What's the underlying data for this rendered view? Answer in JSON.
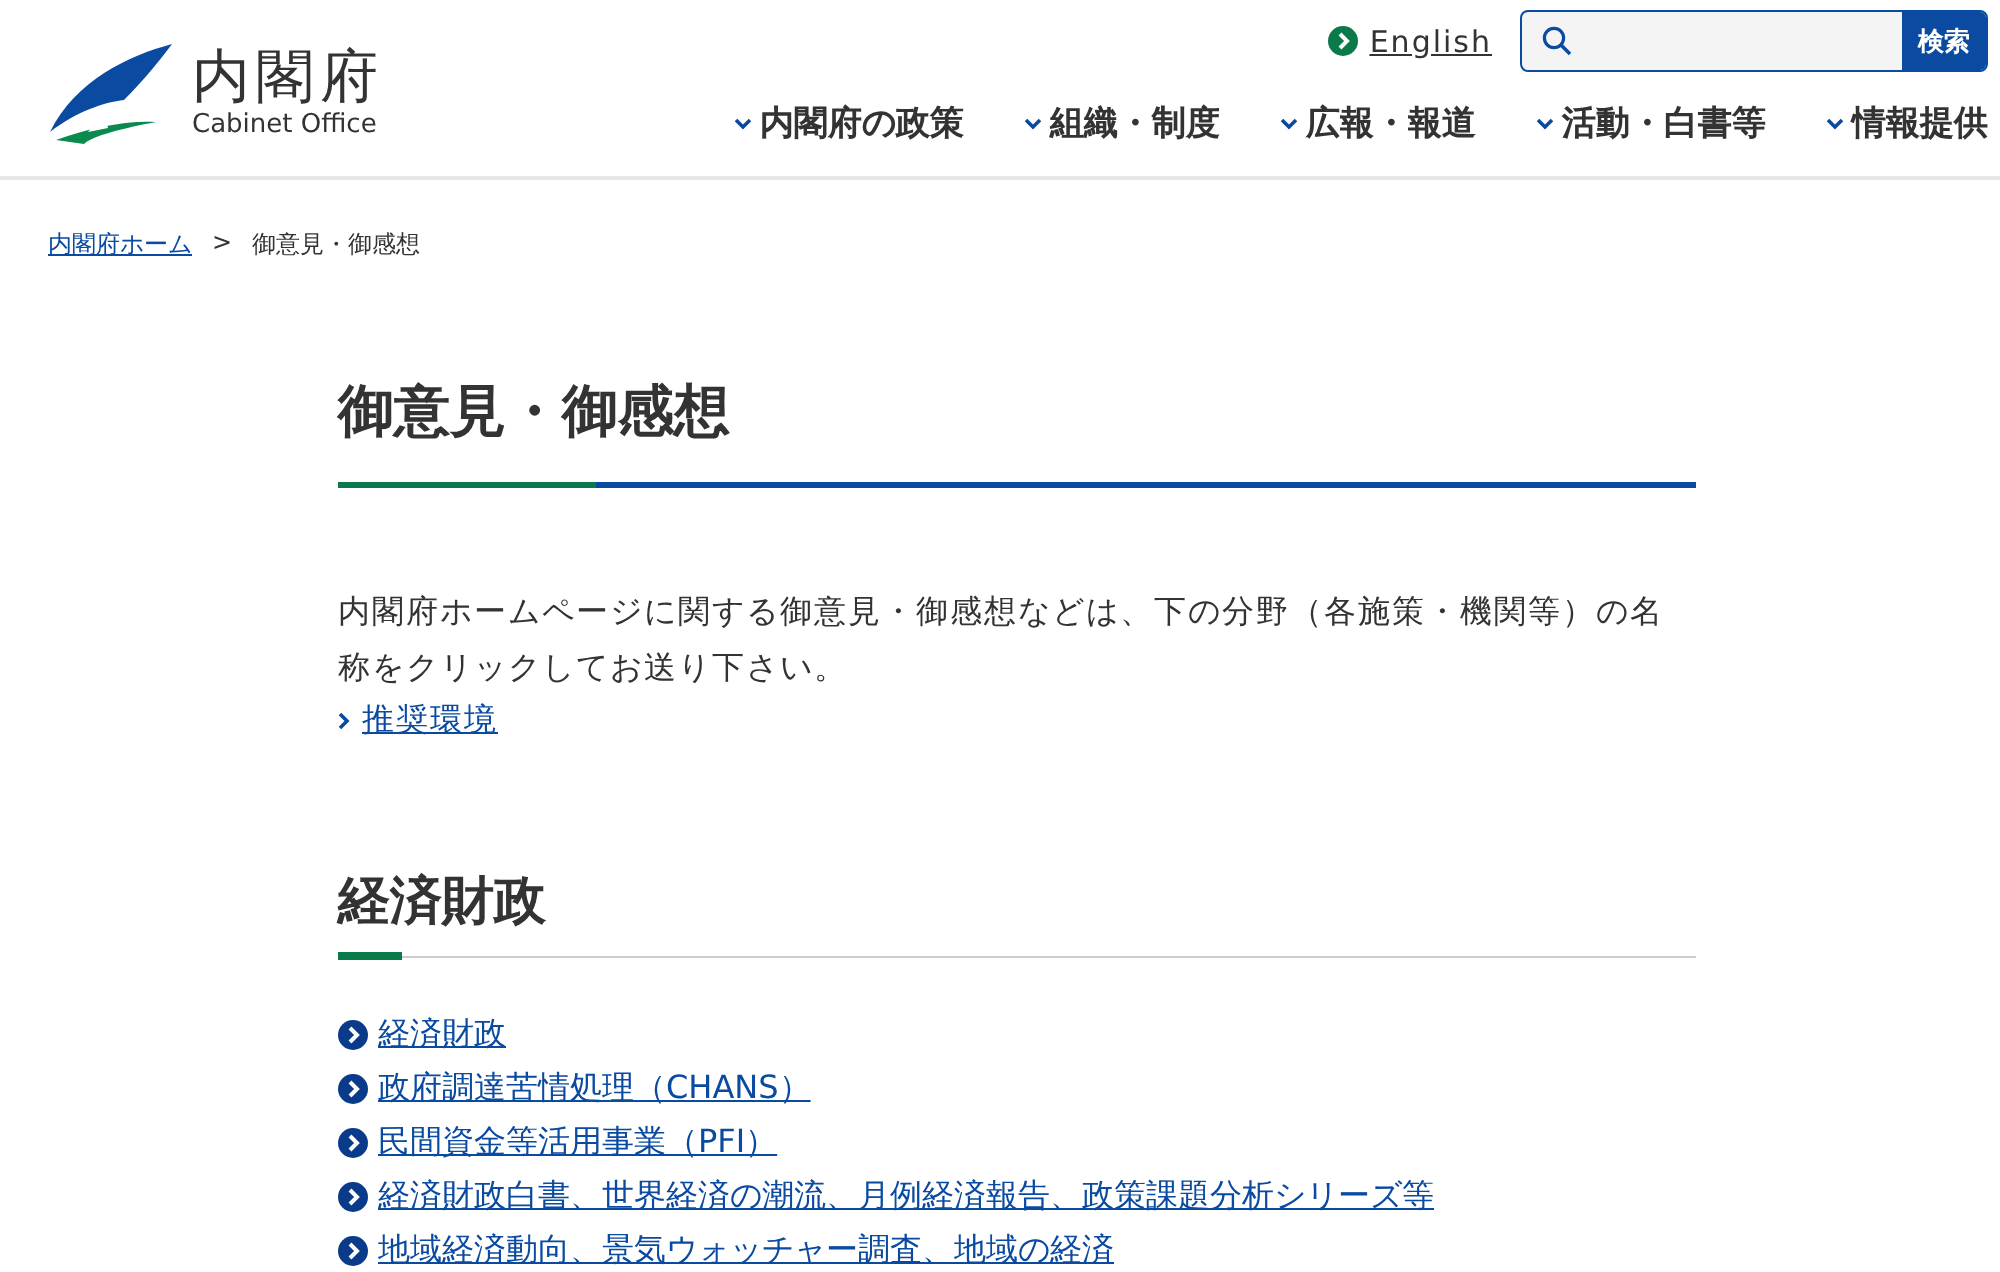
{
  "header": {
    "logo": {
      "name": "内閣府",
      "english": "Cabinet Office"
    },
    "language_link": "English",
    "search": {
      "button": "検索"
    },
    "nav": [
      "内閣府の政策",
      "組織・制度",
      "広報・報道",
      "活動・白書等",
      "情報提供"
    ]
  },
  "breadcrumb": [
    {
      "label": "内閣府ホーム",
      "kind": "link"
    },
    {
      "label": ">",
      "kind": "separator"
    },
    {
      "label": "御意見・御感想",
      "kind": "current"
    }
  ],
  "page_title": "御意見・御感想",
  "intro": "内閣府ホームページに関する御意見・御感想などは、下の分野（各施策・機関等）の名称をクリックしてお送り下さい。",
  "recommended_link": "推奨環境",
  "sections": [
    {
      "heading": "経済財政",
      "links": [
        "経済財政",
        "政府調達苦情処理（CHANS）",
        "民間資金等活用事業（PFI）",
        "経済財政白書、世界経済の潮流、月例経済報告、政策課題分析シリーズ等",
        "地域経済動向、景気ウォッチャー調査、地域の経済"
      ]
    }
  ]
}
